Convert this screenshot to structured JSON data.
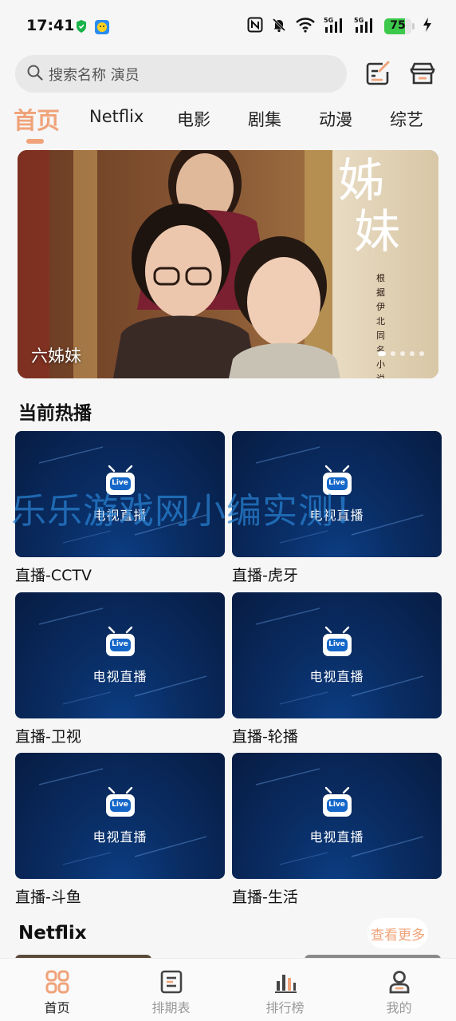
{
  "status_bar": {
    "time": "17:41",
    "battery": "75",
    "battery_level": 0.75,
    "icons": [
      "shield-icon",
      "app-notify-icon",
      "nfc-icon",
      "mute-icon",
      "wifi-icon",
      "signal-5g-icon",
      "signal-5g-icon",
      "battery-icon",
      "charging-icon"
    ]
  },
  "search": {
    "placeholder": "搜索名称 演员"
  },
  "header_icons": [
    "edit-icon",
    "store-icon"
  ],
  "tabs": [
    {
      "label": "首页",
      "active": true
    },
    {
      "label": "Netflix"
    },
    {
      "label": "电影"
    },
    {
      "label": "剧集"
    },
    {
      "label": "动漫"
    },
    {
      "label": "综艺"
    }
  ],
  "banner": {
    "caption": "六姊妹",
    "poster_title": "姊妹",
    "poster_subtitle": "根据伊北同名小说",
    "dots": 5,
    "active_dot": 0
  },
  "hot_section": {
    "title": "当前热播",
    "thumb_text": "电视直播",
    "thumb_badge": "Live",
    "items": [
      {
        "label": "直播-CCTV"
      },
      {
        "label": "直播-虎牙"
      },
      {
        "label": "直播-卫视"
      },
      {
        "label": "直播-轮播"
      },
      {
        "label": "直播-斗鱼"
      },
      {
        "label": "直播-生活"
      }
    ]
  },
  "netflix_section": {
    "title": "Netflix",
    "more": "查看更多"
  },
  "watermark": "乐乐游戏网小编实测！",
  "bottom_nav": [
    {
      "label": "首页",
      "icon": "home-grid-icon",
      "active": true
    },
    {
      "label": "排期表",
      "icon": "schedule-icon"
    },
    {
      "label": "排行榜",
      "icon": "ranking-icon"
    },
    {
      "label": "我的",
      "icon": "profile-icon"
    }
  ],
  "colors": {
    "accent": "#f0a37a",
    "background": "#f6f6f6",
    "thumb_bg": "#0a2e66"
  }
}
